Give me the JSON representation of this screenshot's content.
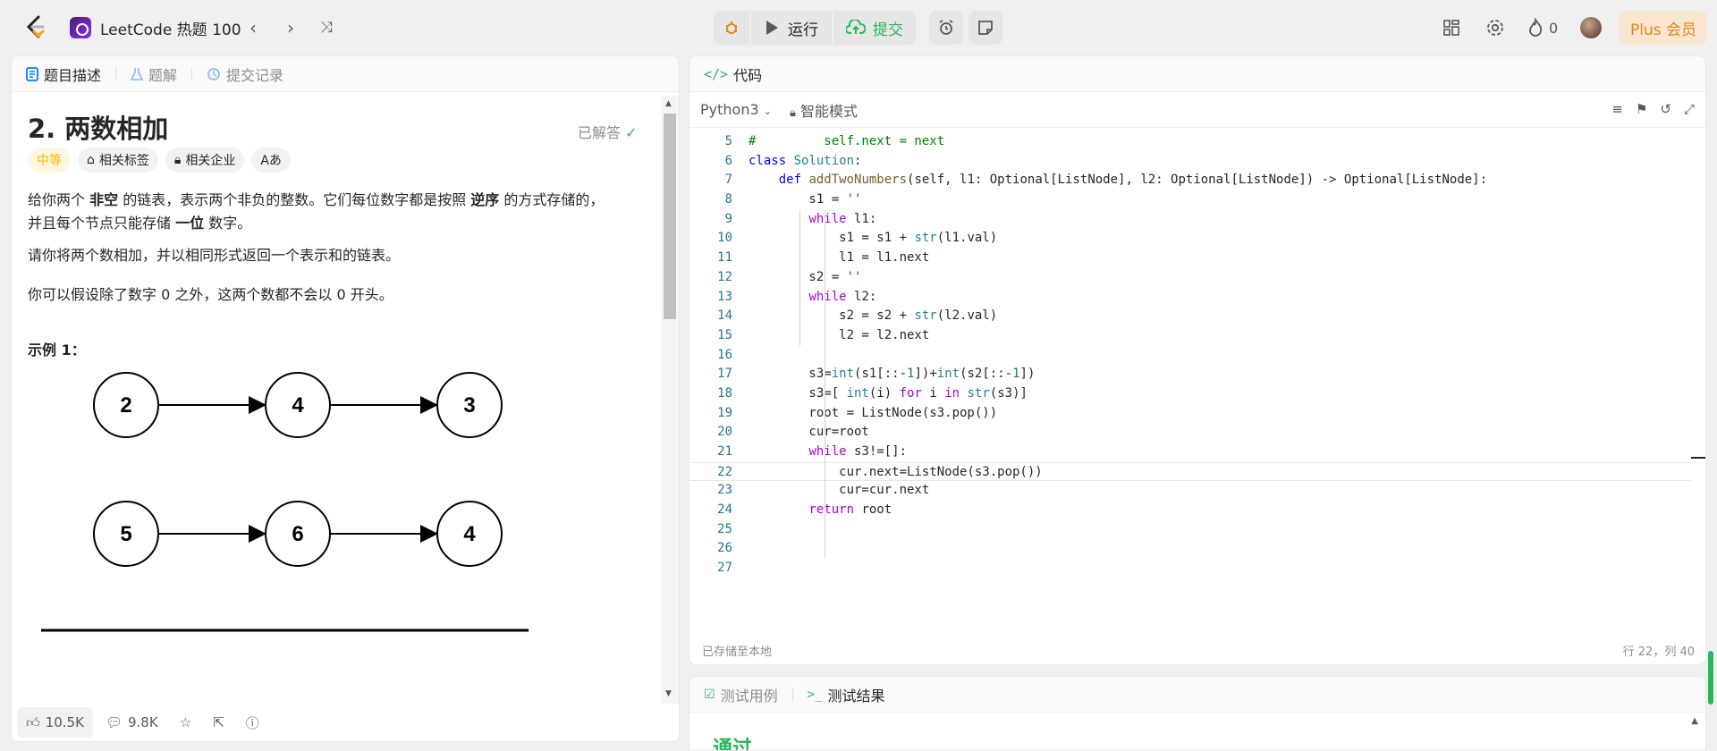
{
  "topbar": {
    "problem_list_title": "LeetCode 热题 100",
    "run_label": "运行",
    "submit_label": "提交",
    "streak_count": "0",
    "plus_label": "Plus 会员"
  },
  "left": {
    "tabs": [
      "题目描述",
      "题解",
      "提交记录"
    ],
    "title": "2. 两数相加",
    "solved_label": "已解答",
    "tags": [
      "中等",
      "相关标签",
      "相关企业",
      "Aあ"
    ],
    "description": {
      "p1_a": "给你两个 ",
      "p1_b": "非空",
      "p1_c": " 的链表，表示两个非负的整数。它们每位数字都是按照 ",
      "p1_d": "逆序",
      "p1_e": " 的方式存储的，",
      "p1_f": "并且每个节点只能存储 ",
      "p1_g": "一位",
      "p1_h": " 数字。",
      "p2": "请你将两个数相加，并以相同形式返回一个表示和的链表。",
      "p3": "你可以假设除了数字 0 之外，这两个数都不会以 0 开头。"
    },
    "example_title": "示例 1：",
    "diagram": {
      "row1": [
        "2",
        "4",
        "3"
      ],
      "row2": [
        "5",
        "6",
        "4"
      ]
    },
    "bottom": {
      "likes": "10.5K",
      "comments": "9.8K"
    }
  },
  "code": {
    "header_label": "代码",
    "language": "Python3",
    "mode": "智能模式",
    "saved_label": "已存储至本地",
    "cursor_pos": "行 22，列 40",
    "lines": [
      {
        "n": "5",
        "t": "#         self.next = next"
      },
      {
        "n": "6",
        "t": "class Solution:"
      },
      {
        "n": "7",
        "t": "    def addTwoNumbers(self, l1: Optional[ListNode], l2: Optional[ListNode]) -> Optional[ListNode]:"
      },
      {
        "n": "8",
        "t": "        s1 = ''"
      },
      {
        "n": "9",
        "t": "        while l1:"
      },
      {
        "n": "10",
        "t": "            s1 = s1 + str(l1.val)"
      },
      {
        "n": "11",
        "t": "            l1 = l1.next"
      },
      {
        "n": "12",
        "t": "        s2 = ''"
      },
      {
        "n": "13",
        "t": "        while l2:"
      },
      {
        "n": "14",
        "t": "            s2 = s2 + str(l2.val)"
      },
      {
        "n": "15",
        "t": "            l2 = l2.next"
      },
      {
        "n": "16",
        "t": ""
      },
      {
        "n": "17",
        "t": "        s3=int(s1[::-1])+int(s2[::-1])"
      },
      {
        "n": "18",
        "t": "        s3=[ int(i) for i in str(s3)]"
      },
      {
        "n": "19",
        "t": "        root = ListNode(s3.pop())"
      },
      {
        "n": "20",
        "t": "        cur=root"
      },
      {
        "n": "21",
        "t": "        while s3!=[]:"
      },
      {
        "n": "22",
        "t": "            cur.next=ListNode(s3.pop())"
      },
      {
        "n": "23",
        "t": "            cur=cur.next"
      },
      {
        "n": "24",
        "t": "        return root"
      },
      {
        "n": "25",
        "t": ""
      },
      {
        "n": "26",
        "t": ""
      },
      {
        "n": "27",
        "t": ""
      }
    ]
  },
  "test": {
    "tabs": [
      "测试用例",
      "测试结果"
    ],
    "result_partial": "通过"
  },
  "colors": {
    "accent_green": "#2db55d",
    "medium_tag": "#ffb800",
    "plus_text": "#e0881f"
  }
}
